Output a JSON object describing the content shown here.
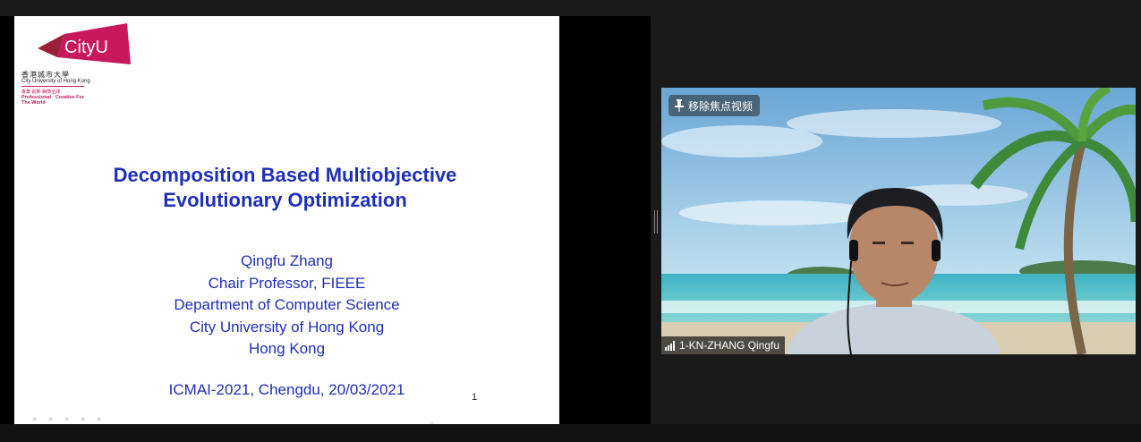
{
  "slide": {
    "logo": {
      "wordmark": "CityU",
      "name_cn": "香港城市大學",
      "name_en": "City University of Hong Kong",
      "tagline_cn": "專業 創新 胸懷全球",
      "tagline_en": "Professional · Creative For The World"
    },
    "title_line1": "Decomposition Based Multiobjective",
    "title_line2": "Evolutionary Optimization",
    "author": {
      "name": "Qingfu Zhang",
      "position": "Chair Professor, FIEEE",
      "department": "Department of Computer Science",
      "university": "City University of Hong Kong",
      "location": "Hong Kong"
    },
    "conference": "ICMAI-2021, Chengdu, 20/03/2021",
    "page_number": "1"
  },
  "video": {
    "unpin_label": "移除焦点视频",
    "participant_name": "1-KN-ZHANG Qingfu"
  },
  "colors": {
    "title_blue": "#1f2fb8",
    "cityu_magenta": "#c8185d",
    "background": "#1a1a1a"
  }
}
